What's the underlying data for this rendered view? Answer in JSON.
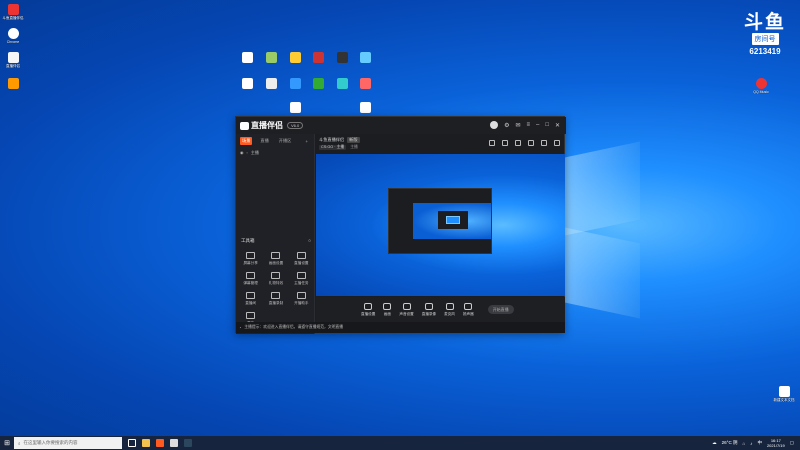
{
  "watermark": {
    "logo": "斗鱼",
    "room_label": "房间号",
    "room_number": "6213419"
  },
  "desktop": {
    "left_icons": [
      "斗鱼直播伴侣",
      "Chrome",
      "直播伴侣"
    ],
    "right_icons": [
      "QQ Music"
    ],
    "center_icons": [
      "",
      "",
      "",
      "",
      "",
      "",
      "",
      "",
      "",
      "",
      "",
      "",
      "",
      ""
    ],
    "file_icon": "新建文本文档"
  },
  "app": {
    "brand": "直播伴侣",
    "version": "V6.0",
    "tabs": [
      "场景",
      "直播",
      "开播区"
    ],
    "scene": "主播",
    "tools_heading": "工具箱",
    "tools": [
      "屏幕分享",
      "画面设置",
      "直播设置",
      "弹幕管理",
      "礼物特效",
      "主播任务",
      "直播间",
      "直播录制",
      "开播助手",
      "更多"
    ],
    "main_title": "斗鱼直播伴侣",
    "main_badge": "新版",
    "category": "CS:GO · 主播",
    "sub_info": "主播",
    "bottom_buttons": [
      "直播设置",
      "画面",
      "声音设置",
      "直播录像",
      "麦克风",
      "扬声器"
    ],
    "start_label": "开始直播",
    "status_text": "主播提示：欢迎进入直播伴侣，请遵守直播规范，文明直播"
  },
  "taskbar": {
    "search_placeholder": "在这里输入你要搜索的内容",
    "weather": "26°C 阴",
    "lang": "中",
    "time": "16:17",
    "date": "2021/7/19"
  },
  "colors": {
    "accent": "#ff5a1f",
    "taskbar": "#16243d"
  }
}
